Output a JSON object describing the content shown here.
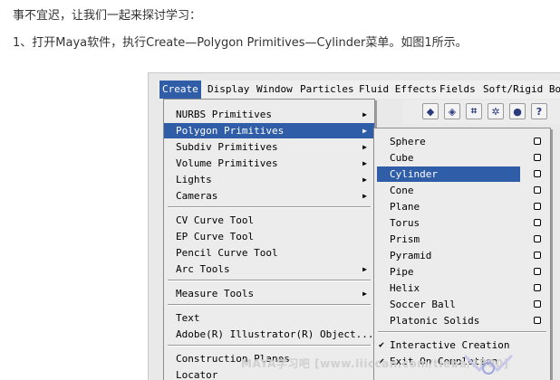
{
  "article": {
    "line1": "事不宜迟，让我们一起来探讨学习：",
    "line2": "1、打开Maya软件，执行Create—Polygon Primitives—Cylinder菜单。如图1所示。"
  },
  "menubar": {
    "items": [
      "Create",
      "Display",
      "Window",
      "Particles",
      "Fluid Effects",
      "Fields",
      "Soft/Rigid Bo"
    ]
  },
  "toolbar": {
    "icons": [
      "polygon-icon",
      "cube-icon",
      "grid-icon",
      "particles-icon",
      "sphere-icon",
      "help-icon"
    ]
  },
  "create_menu": {
    "items": [
      "NURBS Primitives",
      "Polygon Primitives",
      "Subdiv Primitives",
      "Volume Primitives",
      "Lights",
      "Cameras",
      "CV Curve Tool",
      "EP Curve Tool",
      "Pencil Curve Tool",
      "Arc Tools",
      "Measure Tools",
      "Text",
      "Adobe(R) Illustrator(R) Object...",
      "Construction Planes",
      "Locator"
    ]
  },
  "polygon_menu": {
    "items": [
      "Sphere",
      "Cube",
      "Cylinder",
      "Cone",
      "Plane",
      "Torus",
      "Prism",
      "Pyramid",
      "Pipe",
      "Helix",
      "Soccer Ball",
      "Platonic Solids",
      "Interactive Creation",
      "Exit On Completion"
    ]
  },
  "watermark": {
    "text": "MAYA学习吧  [www.liiccan.com/tieba/1800]"
  },
  "colors": {
    "highlight": "#2f5da8",
    "menu_bg": "#ececec"
  }
}
